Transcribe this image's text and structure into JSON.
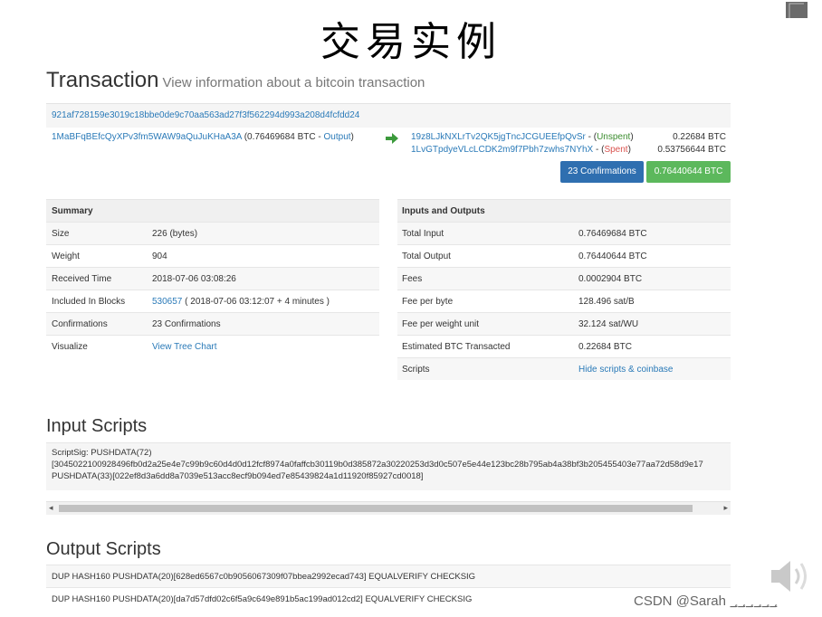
{
  "slide_title": "交易实例",
  "heading": {
    "title": "Transaction",
    "subtitle": "View information about a bitcoin transaction"
  },
  "tx_hash": "921af728159e3019c18bbe0de9c70aa563ad27f3f562294d993a208d4fcfdd24",
  "input": {
    "address": "1MaBFqBEfcQyXPv3fm5WAW9aQuJuKHaA3A",
    "amount_text": "(0.76469684 BTC - ",
    "output_link": "Output",
    "close": ")"
  },
  "outputs": [
    {
      "address": "19z8LJkNXLrTv2QK5jgTncJCGUEEfpQvSr",
      "sep": " - (",
      "status": "Unspent",
      "close": ")",
      "amount": "0.22684 BTC"
    },
    {
      "address": "1LvGTpdyeVLcLCDK2m9f7Pbh7zwhs7NYhX",
      "sep": " - (",
      "status": "Spent",
      "close": ")",
      "amount": "0.53756644 BTC"
    }
  ],
  "badges": {
    "confirmations": "23 Confirmations",
    "total": "0.76440644 BTC"
  },
  "summary": {
    "header": "Summary",
    "rows": [
      {
        "label": "Size",
        "value": "226 (bytes)"
      },
      {
        "label": "Weight",
        "value": "904"
      },
      {
        "label": "Received Time",
        "value": "2018-07-06 03:08:26"
      },
      {
        "label": "Included In Blocks",
        "link": "530657",
        "value": " ( 2018-07-06 03:12:07 + 4 minutes )"
      },
      {
        "label": "Confirmations",
        "value": "23 Confirmations"
      },
      {
        "label": "Visualize",
        "link": "View Tree Chart"
      }
    ]
  },
  "io": {
    "header": "Inputs and Outputs",
    "rows": [
      {
        "label": "Total Input",
        "value": "0.76469684 BTC"
      },
      {
        "label": "Total Output",
        "value": "0.76440644 BTC"
      },
      {
        "label": "Fees",
        "value": "0.0002904 BTC"
      },
      {
        "label": "Fee per byte",
        "value": "128.496 sat/B"
      },
      {
        "label": "Fee per weight unit",
        "value": "32.124 sat/WU"
      },
      {
        "label": "Estimated BTC Transacted",
        "value": "0.22684 BTC"
      },
      {
        "label": "Scripts",
        "link": "Hide scripts & coinbase"
      }
    ]
  },
  "input_scripts": {
    "title": "Input Scripts",
    "lines": [
      "ScriptSig: PUSHDATA(72)",
      "[3045022100928496fb0d2a25e4e7c99b9c60d4d0d12fcf8974a0faffcb30119b0d385872a30220253d3d0c507e5e44e123bc28b795ab4a38bf3b205455403e77aa72d58d9e17",
      "PUSHDATA(33)[022ef8d3a6dd8a7039e513acc8ecf9b094ed7e85439824a1d11920f85927cd0018]"
    ]
  },
  "output_scripts": {
    "title": "Output Scripts",
    "lines": [
      "DUP HASH160 PUSHDATA(20)[628ed6567c0b9056067309f07bbea2992ecad743] EQUALVERIFY CHECKSIG",
      "DUP HASH160 PUSHDATA(20)[da7d57dfd02c6f5a9c649e891b5ac199ad012cd2] EQUALVERIFY CHECKSIG"
    ]
  },
  "watermark": "CSDN @Sarah ؀؀؀؀؀؀",
  "colors": {
    "link": "#2a7ab8",
    "unspent": "#3c8d2f",
    "spent": "#d9534f",
    "badge_blue": "#2f6fb0",
    "badge_green": "#5cb85c"
  }
}
